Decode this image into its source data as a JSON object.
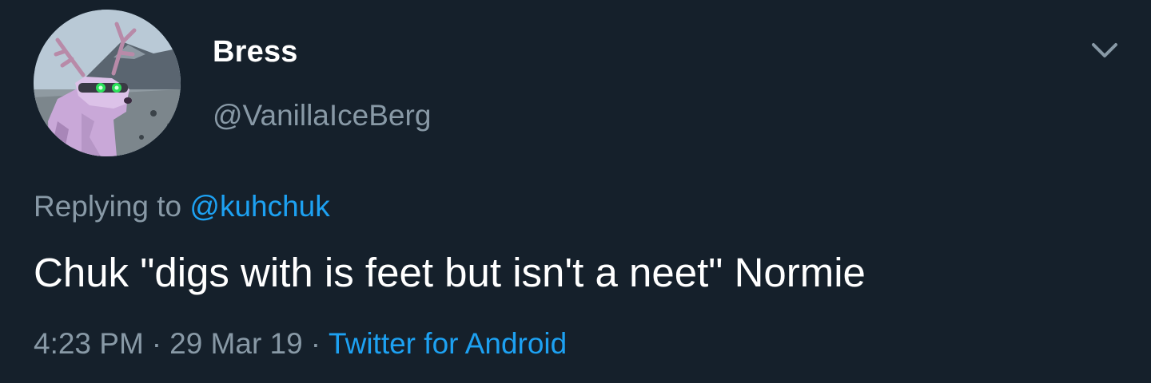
{
  "author": {
    "display_name": "Bress",
    "handle": "@VanillaIceBerg",
    "avatar_icon": "moose-bear-avatar-icon"
  },
  "menu": {
    "icon": "chevron-down-icon"
  },
  "reply": {
    "prefix": "Replying to",
    "mention": "@kuhchuk"
  },
  "tweet": {
    "text": "Chuk \"digs with is feet but isn't a neet\" Normie"
  },
  "meta": {
    "time": "4:23 PM",
    "separator": "·",
    "date": "29 Mar 19",
    "source": "Twitter for Android"
  },
  "colors": {
    "background": "#15202b",
    "primary_text": "#ffffff",
    "secondary_text": "#8899a6",
    "link": "#1da1f2"
  }
}
